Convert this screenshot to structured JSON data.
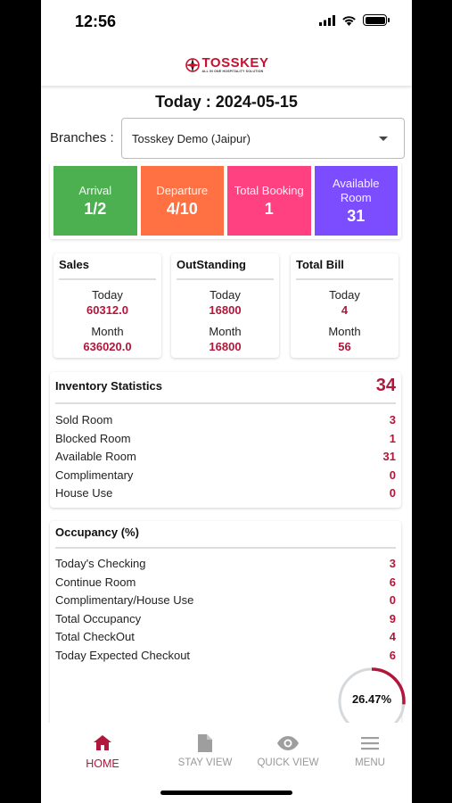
{
  "status_bar": {
    "time": "12:56"
  },
  "header": {
    "logo_text": "TOSSKEY",
    "logo_tagline": "ALL IN ONE HOSPITALITY SOLUTION"
  },
  "date_title": "Today : 2024-05-15",
  "branches": {
    "label": "Branches :",
    "selected": "Tosskey Demo (Jaipur)"
  },
  "tiles": [
    {
      "label": "Arrival",
      "value": "1/2",
      "color": "#4caf50"
    },
    {
      "label": "Departure",
      "value": "4/10",
      "color": "#ff7043"
    },
    {
      "label": "Total Booking",
      "value": "1",
      "color": "#ff4081"
    },
    {
      "label": "Available Room",
      "value": "31",
      "color": "#7c4dff"
    }
  ],
  "summary_cards": [
    {
      "title": "Sales",
      "today_label": "Today",
      "today": "60312.0",
      "month_label": "Month",
      "month": "636020.0"
    },
    {
      "title": "OutStanding",
      "today_label": "Today",
      "today": "16800",
      "month_label": "Month",
      "month": "16800"
    },
    {
      "title": "Total Bill",
      "today_label": "Today",
      "today": "4",
      "month_label": "Month",
      "month": "56"
    }
  ],
  "inventory": {
    "title": "Inventory Statistics",
    "total": "34",
    "rows": [
      {
        "label": "Sold Room",
        "value": "3"
      },
      {
        "label": "Blocked Room",
        "value": "1"
      },
      {
        "label": "Available Room",
        "value": "31"
      },
      {
        "label": "Complimentary",
        "value": "0"
      },
      {
        "label": "House Use",
        "value": "0"
      }
    ]
  },
  "occupancy": {
    "title": "Occupancy (%)",
    "rows": [
      {
        "label": "Today's Checking",
        "value": "3"
      },
      {
        "label": "Continue Room",
        "value": "6"
      },
      {
        "label": "Complimentary/House Use",
        "value": "0"
      },
      {
        "label": "Total Occupancy",
        "value": "9"
      },
      {
        "label": "Total CheckOut",
        "value": "4"
      },
      {
        "label": "Today Expected Checkout",
        "value": "6"
      }
    ],
    "gauge_label": "26.47%",
    "gauge_fraction": 0.2647,
    "gauge_color": "#b0173a"
  },
  "tabbar": [
    {
      "label": "HOME",
      "icon": "home-icon",
      "active": true
    },
    {
      "label": "STAY VIEW",
      "icon": "document-icon",
      "active": false
    },
    {
      "label": "QUICK VIEW",
      "icon": "eye-icon",
      "active": false
    },
    {
      "label": "MENU",
      "icon": "menu-icon",
      "active": false
    }
  ]
}
